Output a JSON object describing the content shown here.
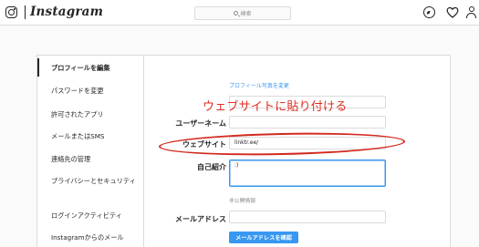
{
  "nav": {
    "logo_text": "Instagram",
    "search_placeholder": "検索",
    "icons": [
      "instagram-glyph-icon",
      "search-icon",
      "compass-icon",
      "heart-icon",
      "profile-icon"
    ]
  },
  "sidebar": {
    "items": [
      {
        "label": "プロフィールを編集",
        "active": true
      },
      {
        "label": "パスワードを変更"
      },
      {
        "label": "許可されたアプリ"
      },
      {
        "label": "メールまたはSMS"
      },
      {
        "label": "連絡先の管理"
      },
      {
        "label": "プライバシーとセキュリティ"
      },
      {
        "label": "ログインアクティビティ"
      },
      {
        "label": "Instagramからのメール"
      }
    ]
  },
  "form": {
    "change_photo_link": "プロフィール写真を変更",
    "username_label": "ユーザーネーム",
    "website_label": "ウェブサイト",
    "website_value": "linktr.ee/",
    "bio_label": "自己紹介",
    "bio_value": ":)",
    "private_info_heading": "非公開情報",
    "email_label": "メールアドレス",
    "confirm_email_button": "メールアドレスを確認"
  },
  "annotation": {
    "text": "ウェブサイトに貼り付ける",
    "color": "#e02b20"
  },
  "colors": {
    "accent": "#3897f0",
    "border": "#dbdbdb",
    "background": "#fafafa"
  }
}
